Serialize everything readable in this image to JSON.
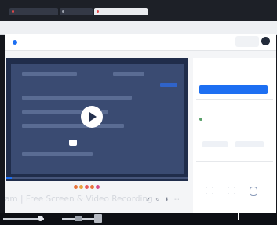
{
  "browser": {
    "tabs": [
      {
        "label": ""
      },
      {
        "label": ""
      },
      {
        "label": ""
      }
    ],
    "address": ""
  },
  "header": {
    "links": [
      "",
      "",
      ""
    ]
  },
  "video": {
    "title": "am | Free Screen & Video Recording",
    "speeds": [
      "",
      "",
      "",
      "",
      ""
    ],
    "progress": 0.03,
    "accent_color": "#1d6ff2"
  },
  "sidebar": {
    "card1": {
      "heading": "",
      "text": "",
      "button": ""
    },
    "card2": {
      "heading": "",
      "text": "",
      "btn_a": "",
      "btn_b": ""
    },
    "card3": {
      "heading": ""
    }
  },
  "icons": {
    "play": "play-icon",
    "mic": "microphone-icon"
  }
}
